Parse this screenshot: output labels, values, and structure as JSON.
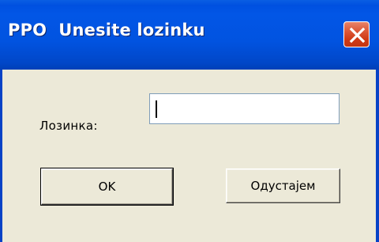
{
  "window": {
    "title": "PPO  Unesite lozinku",
    "close_icon": "close-icon"
  },
  "form": {
    "password_label": "Лозинка:",
    "password_value": "",
    "password_placeholder": ""
  },
  "buttons": {
    "ok_label": "OK",
    "cancel_label": "Одустајем"
  },
  "colors": {
    "titlebar": "#0153e0",
    "close_button": "#dd5a3a",
    "dialog_background": "#ece9d8"
  }
}
